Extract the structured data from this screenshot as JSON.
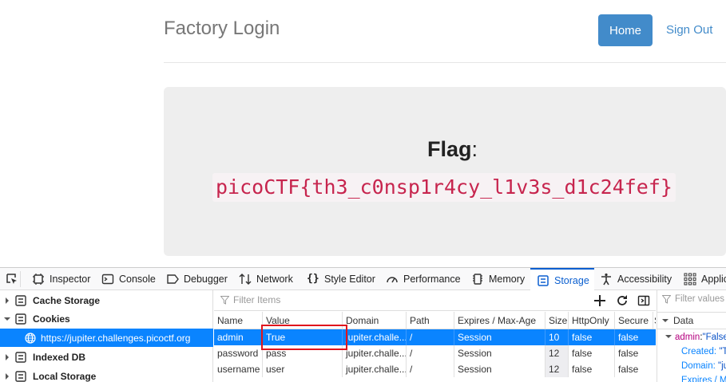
{
  "page": {
    "brand": "Factory Login",
    "nav": {
      "home": "Home",
      "sign_out": "Sign Out"
    },
    "flag_label": "Flag",
    "flag_colon": ":",
    "flag_value": "picoCTF{th3_c0nsp1r4cy_l1v3s_d1c24fef}"
  },
  "devtools": {
    "tabs": [
      "Inspector",
      "Console",
      "Debugger",
      "Network",
      "Style Editor",
      "Performance",
      "Memory",
      "Storage",
      "Accessibility",
      "Applic"
    ],
    "active_tab": "Storage",
    "tree": {
      "cache_storage": "Cache Storage",
      "cookies": "Cookies",
      "cookie_host": "https://jupiter.challenges.picoctf.org",
      "indexed_db": "Indexed DB",
      "local_storage": "Local Storage"
    },
    "filter_placeholder": "Filter Items",
    "columns": [
      "Name",
      "Value",
      "Domain",
      "Path",
      "Expires / Max-Age",
      "Size",
      "HttpOnly",
      "Secure",
      "S"
    ],
    "rows": [
      [
        "admin",
        "True",
        "jupiter.challe...",
        "/",
        "Session",
        "10",
        "false",
        "false"
      ],
      [
        "password",
        "pass",
        "jupiter.challe...",
        "/",
        "Session",
        "12",
        "false",
        "false"
      ],
      [
        "username",
        "user",
        "jupiter.challe...",
        "/",
        "Session",
        "12",
        "false",
        "false"
      ]
    ],
    "sidebar": {
      "filter_placeholder": "Filter values",
      "section": "Data",
      "entry_key": "admin",
      "entry_value": "\"False",
      "created_label": "Created:",
      "created_value": "\"Tu",
      "domain_label": "Domain:",
      "domain_value": "\"ju",
      "expires_label": "Expires / Ma"
    }
  }
}
